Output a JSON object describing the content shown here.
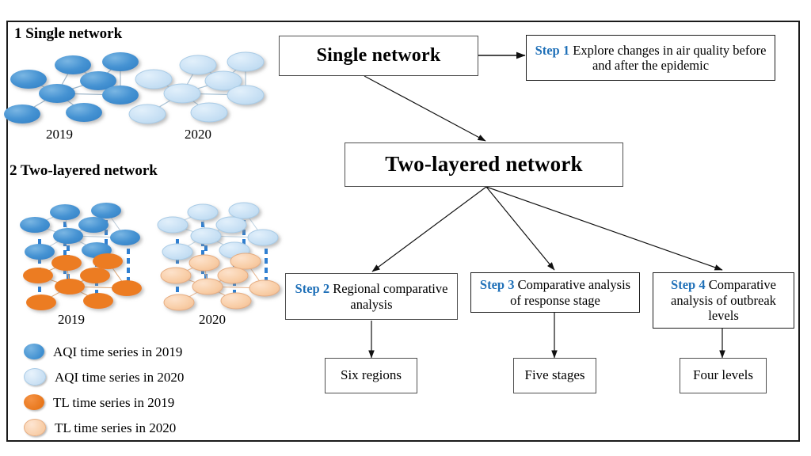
{
  "figure": {
    "panel_titles": [
      {
        "id": "single-network",
        "text": "1 Single network"
      },
      {
        "id": "two-layered-network",
        "text": "2 Two-layered network"
      }
    ],
    "year_labels": {
      "single_2019": "2019",
      "single_2020": "2020",
      "layered_2019": "2019",
      "layered_2020": "2020"
    },
    "legend": [
      {
        "label": "AQI time series in 2019",
        "color": "#3f8fd0"
      },
      {
        "label": "AQI time series in 2020",
        "color": "#c8dff3"
      },
      {
        "label": "TL time series in 2019",
        "color": "#e8771c"
      },
      {
        "label": "TL time series in 2020",
        "color": "#f8cda6"
      }
    ],
    "colors": {
      "aqi_2019": "#3f8fd0",
      "aqi_2020": "#c8dff3",
      "tl_2019": "#e8771c",
      "tl_2020": "#f8cda6",
      "step_accent": "#1f70b8",
      "interlayer_link": "#2f7fd1",
      "frame": "#1a1a1a"
    },
    "flow": {
      "single_network": {
        "title": "Single network"
      },
      "two_layered_network": {
        "title": "Two-layered network"
      },
      "steps": [
        {
          "id": "step-1",
          "label": "Step 1",
          "text": "Explore changes in air quality before and after the epidemic"
        },
        {
          "id": "step-2",
          "label": "Step 2",
          "text": "Regional comparative analysis"
        },
        {
          "id": "step-3",
          "label": "Step 3",
          "text": "Comparative analysis of response stage"
        },
        {
          "id": "step-4",
          "label": "Step 4",
          "text": "Comparative analysis of outbreak levels"
        }
      ],
      "results": [
        {
          "id": "result-six-regions",
          "text": "Six regions"
        },
        {
          "id": "result-five-stages",
          "text": "Five stages"
        },
        {
          "id": "result-four-levels",
          "text": "Four levels"
        }
      ]
    }
  }
}
